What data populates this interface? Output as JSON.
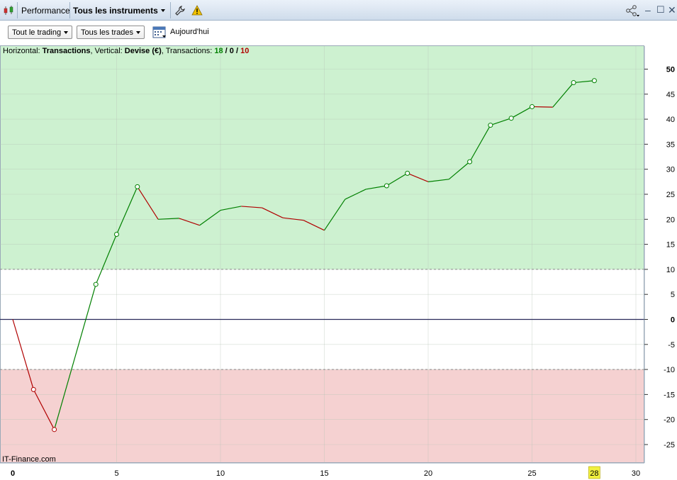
{
  "window": {
    "title": "Performance",
    "instrument_selector": "Tous les instruments"
  },
  "toolbar": {
    "trading_filter": "Tout le trading",
    "trades_filter": "Tous les trades",
    "date_label": "Aujourd'hui"
  },
  "info": {
    "h_prefix": "Horizontal: ",
    "h_value": "Transactions",
    "v_prefix": ", Vertical: ",
    "v_value": "Devise (€)",
    "t_prefix": ", Transactions: ",
    "wins": "18",
    "slash1": " / ",
    "neutral": "0",
    "slash2": " / ",
    "losses": "10"
  },
  "credit": "IT-Finance.com",
  "colors": {
    "up": "#008000",
    "down": "#b00000",
    "profit_zone": "#cdf1d0",
    "loss_zone": "#f5d1d1",
    "zero_line": "#2a2a5a",
    "highlight": "#f0f040"
  },
  "chart_data": {
    "type": "line",
    "x": [
      0,
      1,
      2,
      3,
      4,
      5,
      6,
      7,
      8,
      9,
      10,
      11,
      12,
      13,
      14,
      15,
      16,
      17,
      18,
      19,
      20,
      21,
      22,
      23,
      24,
      25,
      26,
      27,
      28
    ],
    "y": [
      0,
      -14,
      -22,
      -7.5,
      7,
      17,
      26.5,
      20,
      20.2,
      18.8,
      21.8,
      22.6,
      22.3,
      20.3,
      19.8,
      17.8,
      24,
      26,
      26.7,
      29.2,
      27.5,
      28,
      31.5,
      38.8,
      40.2,
      42.5,
      42.4,
      47.3,
      47.7
    ],
    "markers": [
      1,
      2,
      4,
      5,
      6,
      18,
      19,
      22,
      23,
      24,
      25,
      27,
      28
    ],
    "xlim": [
      0,
      30
    ],
    "ylim": [
      -29,
      55
    ],
    "xticks": [
      "0",
      "5",
      "10",
      "15",
      "20",
      "25",
      "30"
    ],
    "xtick_values": [
      0,
      5,
      10,
      15,
      20,
      25,
      30
    ],
    "highlight_x": "28",
    "yticks": [
      "50",
      "45",
      "40",
      "35",
      "30",
      "25",
      "20",
      "15",
      "10",
      "5",
      "0",
      "-5",
      "-10",
      "-15",
      "-20",
      "-25"
    ],
    "ytick_values": [
      50,
      45,
      40,
      35,
      30,
      25,
      20,
      15,
      10,
      5,
      0,
      -5,
      -10,
      -15,
      -20,
      -25
    ],
    "zone_upper": 10,
    "zone_lower": -10,
    "grid": true
  }
}
